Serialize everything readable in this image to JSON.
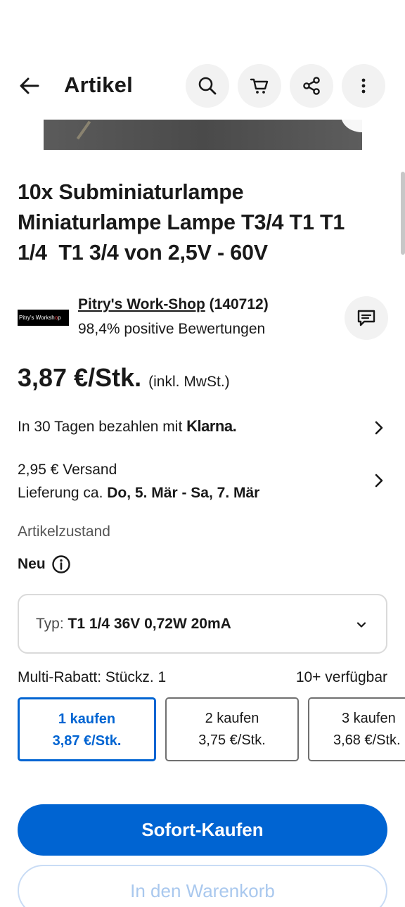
{
  "header": {
    "title": "Artikel",
    "icons": [
      "back-arrow-icon",
      "search-icon",
      "cart-icon",
      "share-icon",
      "more-vertical-icon"
    ]
  },
  "item": {
    "title_line1": "10x Subminiaturlampe",
    "title_line2": "Miniaturlampe Lampe T3/4 T1 T1",
    "title_line3": "1/4  T1 3/4 von 2,5V - 60V"
  },
  "seller": {
    "logo_text_a": "Pitry's Worksh",
    "logo_text_b": "o",
    "logo_text_c": "p",
    "name": "Pitry's Work-Shop",
    "feedback_count": "(140712)",
    "rating": "98,4% positive Bewertungen"
  },
  "price": {
    "value": "3,87 €/Stk.",
    "tax_note": "(inkl. MwSt.)"
  },
  "payment": {
    "text": "In 30 Tagen bezahlen mit",
    "brand": "Klarna."
  },
  "shipping": {
    "cost": "2,95 € Versand",
    "delivery_prefix": "Lieferung ca.",
    "delivery_dates": "Do, 5. Mär - Sa, 7. Mär"
  },
  "condition": {
    "label": "Artikelzustand",
    "value": "Neu"
  },
  "variant": {
    "label": "Typ:",
    "value": "T1 1/4 36V 0,72W 20mA"
  },
  "multi_buy": {
    "label": "Multi-Rabatt: Stückz. 1",
    "availability": "10+ verfügbar",
    "options": [
      {
        "qty": "1 kaufen",
        "price": "3,87 €/Stk.",
        "selected": true
      },
      {
        "qty": "2 kaufen",
        "price": "3,75 €/Stk.",
        "selected": false
      },
      {
        "qty": "3 kaufen",
        "price": "3,68 €/Stk.",
        "selected": false
      }
    ]
  },
  "actions": {
    "buy_now": "Sofort-Kaufen",
    "add_to_cart": "In den Warenkorb"
  },
  "colors": {
    "accent": "#0064d2",
    "text": "#191919",
    "icon_bg": "#f2f2f2"
  }
}
